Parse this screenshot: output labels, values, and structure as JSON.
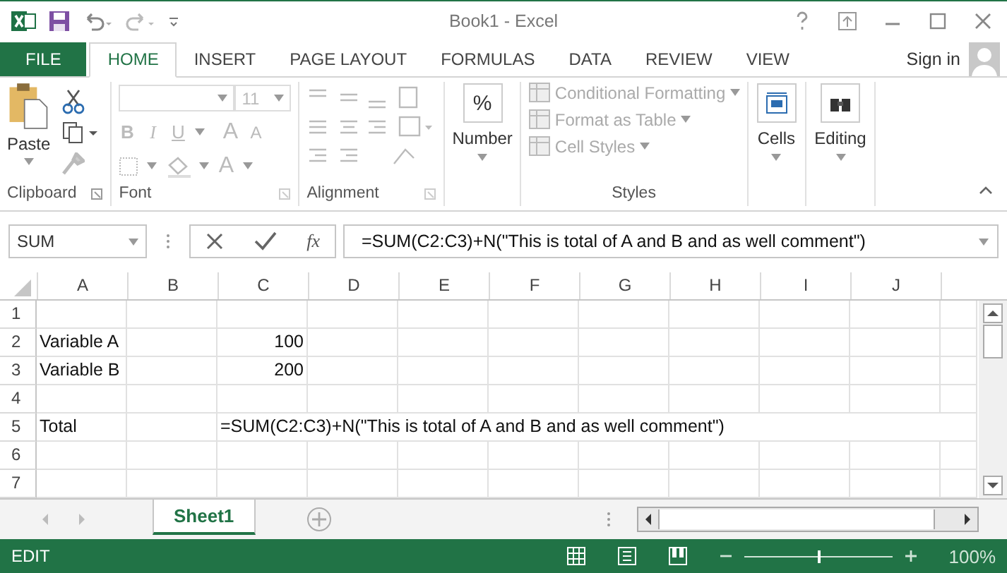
{
  "window": {
    "title": "Book1 - Excel"
  },
  "ribbon_tabs": [
    {
      "label": "FILE",
      "kind": "file",
      "selected": false
    },
    {
      "label": "HOME",
      "kind": "tab",
      "selected": true
    },
    {
      "label": "INSERT",
      "kind": "tab",
      "selected": false
    },
    {
      "label": "PAGE LAYOUT",
      "kind": "tab",
      "selected": false
    },
    {
      "label": "FORMULAS",
      "kind": "tab",
      "selected": false
    },
    {
      "label": "DATA",
      "kind": "tab",
      "selected": false
    },
    {
      "label": "REVIEW",
      "kind": "tab",
      "selected": false
    },
    {
      "label": "VIEW",
      "kind": "tab",
      "selected": false
    }
  ],
  "account": {
    "label": "Sign in"
  },
  "ribbon": {
    "clipboard": {
      "paste": "Paste",
      "group": "Clipboard"
    },
    "font": {
      "size": "11",
      "bold": "B",
      "italic": "I",
      "underline": "U",
      "grow": "A",
      "shrink": "A",
      "font_color": "A",
      "group": "Font",
      "disabled": true
    },
    "alignment": {
      "group": "Alignment",
      "disabled": true
    },
    "number": {
      "symbol": "%",
      "label": "Number"
    },
    "styles": {
      "items": [
        "Conditional Formatting",
        "Format as Table",
        "Cell Styles"
      ],
      "group": "Styles",
      "disabled": true
    },
    "cells": {
      "label": "Cells"
    },
    "editing": {
      "label": "Editing"
    }
  },
  "formula_bar": {
    "name_box": "SUM",
    "fx": "fx",
    "formula": "=SUM(C2:C3)+N(\"This is total of A and B and as well comment\")"
  },
  "sheet": {
    "columns": [
      "A",
      "B",
      "C",
      "D",
      "E",
      "F",
      "G",
      "H",
      "I",
      "J"
    ],
    "rows": [
      {
        "header": "1",
        "cells": []
      },
      {
        "header": "2",
        "cells": [
          {
            "text": "Variable A",
            "kind": "text"
          },
          {},
          {
            "text": "100",
            "kind": "number"
          }
        ]
      },
      {
        "header": "3",
        "cells": [
          {
            "text": "Variable B",
            "kind": "text"
          },
          {},
          {
            "text": "200",
            "kind": "number"
          }
        ]
      },
      {
        "header": "4",
        "cells": []
      },
      {
        "header": "5",
        "cells": [
          {
            "text": "Total",
            "kind": "text"
          },
          {},
          {
            "text": "=SUM(C2:C3)+N(\"This is total of A and B and as well comment\")",
            "kind": "text"
          }
        ]
      },
      {
        "header": "6",
        "cells": []
      },
      {
        "header": "7",
        "cells": []
      }
    ]
  },
  "sheet_tabs": [
    {
      "label": "Sheet1",
      "selected": true
    }
  ],
  "status_bar": {
    "mode": "EDIT",
    "zoom_slider": {
      "level": 0.5
    },
    "zoom": "100%"
  }
}
